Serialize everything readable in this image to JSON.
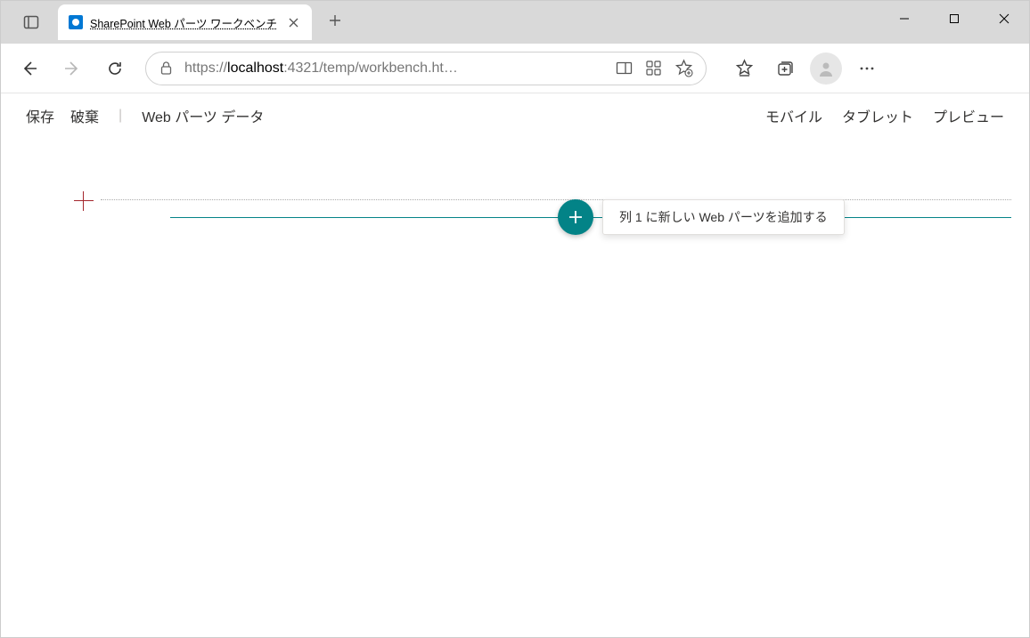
{
  "browser": {
    "tab_title": "SharePoint Web パーツ ワークベンチ",
    "url_prefix": "https://",
    "url_host": "localhost",
    "url_rest": ":4321/temp/workbench.ht…"
  },
  "workbench": {
    "save": "保存",
    "discard": "破棄",
    "webpart_data": "Web パーツ データ",
    "mobile": "モバイル",
    "tablet": "タブレット",
    "preview": "プレビュー",
    "tooltip": "列 1 に新しい Web パーツを追加する"
  }
}
